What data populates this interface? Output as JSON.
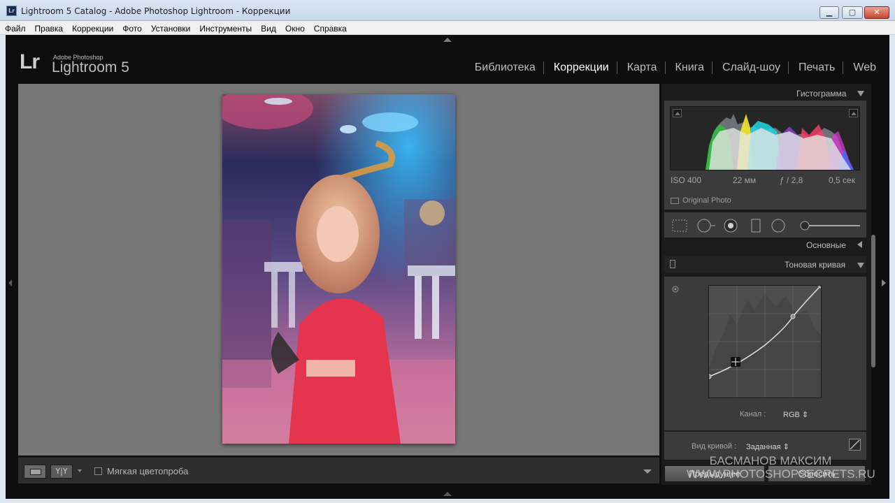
{
  "window": {
    "title": "Lightroom 5 Catalog - Adobe Photoshop Lightroom - Коррекции",
    "app_icon": "Lr",
    "min_label": "▁",
    "max_label": "▢",
    "close_label": "✕"
  },
  "menu": [
    "Файл",
    "Правка",
    "Коррекции",
    "Фото",
    "Установки",
    "Инструменты",
    "Вид",
    "Окно",
    "Справка"
  ],
  "logo": {
    "mark": "Lr",
    "brand": "Adobe Photoshop",
    "product": "Lightroom 5"
  },
  "modules": [
    "Библиотека",
    "Коррекции",
    "Карта",
    "Книга",
    "Слайд-шоу",
    "Печать",
    "Web"
  ],
  "active_module": "Коррекции",
  "toolbar": {
    "yy_label": "Y|Y",
    "soft_proof_label": "Мягкая цветопроба"
  },
  "histogram": {
    "title": "Гистограмма",
    "iso": "ISO 400",
    "focal": "22 мм",
    "aperture": "ƒ / 2,8",
    "shutter": "0,5 сек",
    "original_label": "Original Photo"
  },
  "sections": {
    "basic": "Основные",
    "tone_curve": "Тоновая кривая"
  },
  "tone_curve": {
    "channel_label": "Канал :",
    "channel_value": "RGB ⇕",
    "curve_view_label": "Вид кривой :",
    "curve_view_value": "Заданная ⇕"
  },
  "buttons": {
    "previous": "Предыдущее",
    "reset": "Сбросить"
  },
  "watermark": {
    "line1": "БАСМАНОВ МАКСИМ",
    "line2": "WWW.PHOTOSHOPSECRETS.RU"
  }
}
